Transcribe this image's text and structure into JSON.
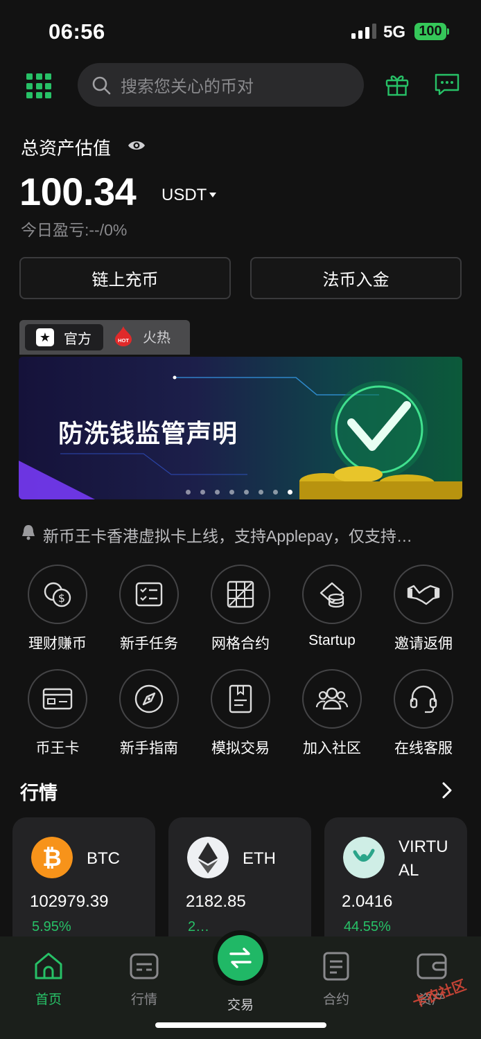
{
  "status_bar": {
    "time": "06:56",
    "network": "5G",
    "battery": "100"
  },
  "header": {
    "search_placeholder": "搜索您关心的币对",
    "menu_icon": "grid-menu-icon",
    "gift_icon": "gift-icon",
    "chat_icon": "chat-icon"
  },
  "assets": {
    "label": "总资产估值",
    "value": "100.34",
    "unit": "USDT",
    "pnl": "今日盈亏:--/0%"
  },
  "actions": {
    "deposit": "链上充币",
    "fiat": "法币入金"
  },
  "tabs": {
    "official": "官方",
    "hot": "火热",
    "hot_badge": "HOT"
  },
  "banner": {
    "title": "防洗钱监管声明"
  },
  "notice": {
    "text": "新币王卡香港虚拟卡上线，支持Applepay，仅支持…"
  },
  "shortcuts": [
    {
      "label": "理财赚币",
      "icon": "coin-dollar-icon"
    },
    {
      "label": "新手任务",
      "icon": "task-list-icon"
    },
    {
      "label": "网格合约",
      "icon": "grid-table-icon"
    },
    {
      "label": "Startup",
      "icon": "coin-stack-icon"
    },
    {
      "label": "邀请返佣",
      "icon": "handshake-icon"
    },
    {
      "label": "币王卡",
      "icon": "card-icon"
    },
    {
      "label": "新手指南",
      "icon": "compass-icon"
    },
    {
      "label": "模拟交易",
      "icon": "document-icon"
    },
    {
      "label": "加入社区",
      "icon": "community-icon"
    },
    {
      "label": "在线客服",
      "icon": "headset-icon"
    }
  ],
  "market": {
    "title": "行情",
    "coins": [
      {
        "name": "BTC",
        "price": "102979.39",
        "change": "5.95%"
      },
      {
        "name": "ETH",
        "price": "2182.85",
        "change": "2…"
      },
      {
        "name": "VIRTU\nAL",
        "price": "2.0416",
        "change": "44.55%"
      }
    ]
  },
  "nav": {
    "home": "首页",
    "market": "行情",
    "trade": "交易",
    "contract": "合约",
    "assets": "资产"
  },
  "watermark": "卡农社区",
  "colors": {
    "accent": "#27c167",
    "background": "#121212",
    "card": "#232325"
  }
}
